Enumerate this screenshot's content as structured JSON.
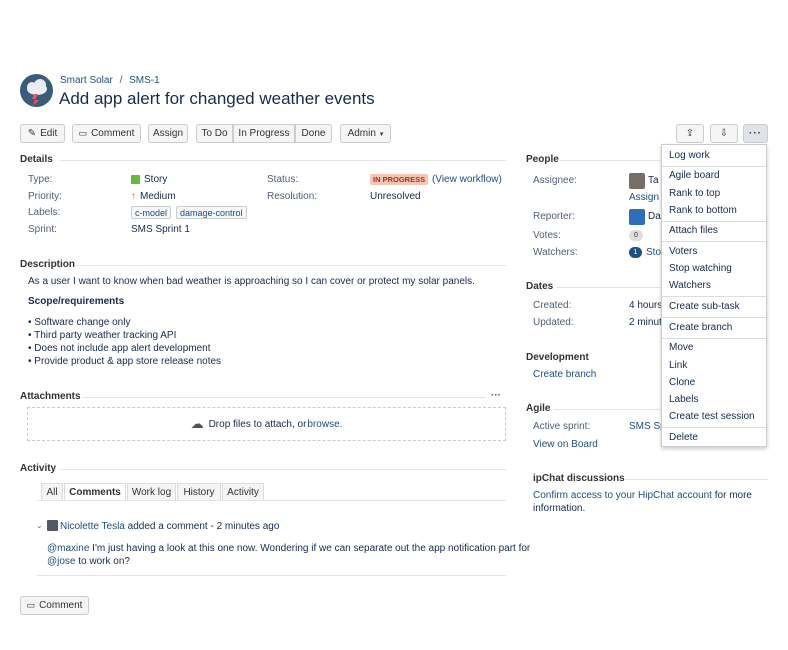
{
  "breadcrumb": {
    "project": "Smart Solar",
    "separator": "/",
    "issue_key": "SMS-1"
  },
  "issue": {
    "title": "Add app alert for changed weather events"
  },
  "toolbar": {
    "edit": "Edit",
    "comment": "Comment",
    "assign": "Assign",
    "todo": "To Do",
    "inprogress": "In Progress",
    "done": "Done",
    "admin": "Admin"
  },
  "details": {
    "heading": "Details",
    "type_label": "Type:",
    "type_value": "Story",
    "priority_label": "Priority:",
    "priority_value": "Medium",
    "labels_label": "Labels:",
    "labels": [
      "c-model",
      "damage-control"
    ],
    "sprint_label": "Sprint:",
    "sprint_value": "SMS Sprint 1",
    "status_label": "Status:",
    "status_value": "IN PROGRESS",
    "view_workflow": "(View workflow)",
    "resolution_label": "Resolution:",
    "resolution_value": "Unresolved"
  },
  "description": {
    "heading": "Description",
    "text": "As a user I want to know when bad weather is approaching so I can cover or protect my solar panels.",
    "subheading": "Scope/requirements",
    "bullets": [
      "• Software change only",
      "• Third party weather tracking API",
      "• Does not include app alert development",
      "• Provide product & app store release notes"
    ]
  },
  "attachments": {
    "heading": "Attachments",
    "drop_text": "Drop files to attach, or ",
    "browse": "browse."
  },
  "activity": {
    "heading": "Activity",
    "tabs": [
      "All",
      "Comments",
      "Work log",
      "History",
      "Activity"
    ],
    "comment_author": "Nicolette Tesla",
    "comment_meta": " added a comment - 2 minutes ago",
    "mention1": "@maxine",
    "comment_text1": " I'm just having a look at this one now. Wondering if we can separate out the app notification part for",
    "mention2": "@jose",
    "comment_text2": " to work on?",
    "comment_button": "Comment"
  },
  "people": {
    "heading": "People",
    "assignee_label": "Assignee:",
    "assignee_name": "Ta",
    "assign_link": "Assign",
    "reporter_label": "Reporter:",
    "reporter_name": "Da",
    "votes_label": "Votes:",
    "votes_count": "0",
    "watchers_label": "Watchers:",
    "watchers_count": "1",
    "watchers_link": "Sto"
  },
  "dates": {
    "heading": "Dates",
    "created_label": "Created:",
    "created_value": "4 hours",
    "updated_label": "Updated:",
    "updated_value": "2 minut"
  },
  "development": {
    "heading": "Development",
    "create_branch": "Create branch"
  },
  "agile": {
    "heading": "Agile",
    "sprint_label": "Active sprint:",
    "sprint_value": "SMS Sp",
    "view_board": "View on Board"
  },
  "hipchat": {
    "heading": "ipChat discussions",
    "link": "Confirm access to your HipChat account",
    "text1": " for more",
    "text2": "information."
  },
  "more_menu": {
    "items": [
      "Log work",
      "Agile board",
      "Rank to top",
      "Rank to bottom",
      "Attach files",
      "Voters",
      "Stop watching",
      "Watchers",
      "Create sub-task",
      "Create branch",
      "Move",
      "Link",
      "Clone",
      "Labels",
      "Create test session",
      "Delete"
    ]
  },
  "colors": {
    "link": "#205081",
    "status_bg": "#f4b400",
    "status_text": "#a54b00",
    "story_green": "#63ba3c",
    "priority": "#f15c29"
  }
}
